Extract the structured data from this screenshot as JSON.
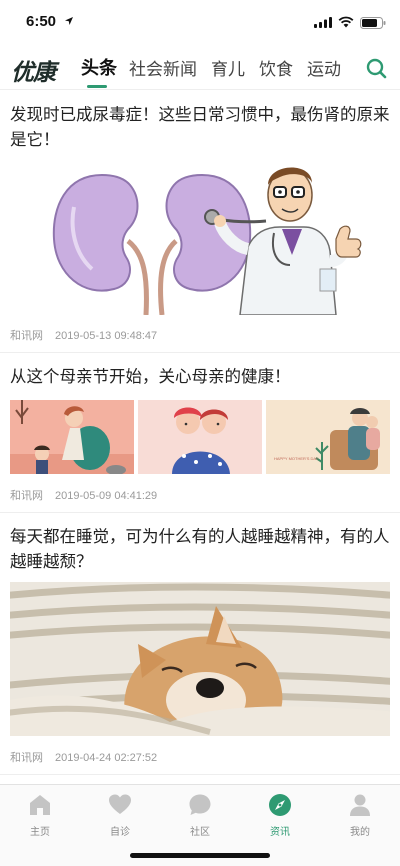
{
  "status": {
    "time": "6:50"
  },
  "header": {
    "logo": "优康",
    "tabs": [
      {
        "label": "头条",
        "active": true
      },
      {
        "label": "社会新闻",
        "active": false
      },
      {
        "label": "育儿",
        "active": false
      },
      {
        "label": "饮食",
        "active": false
      },
      {
        "label": "运动",
        "active": false
      }
    ]
  },
  "articles": [
    {
      "title": "发现时已成尿毒症！这些日常习惯中，最伤肾的原来是它！",
      "source": "和讯网",
      "time": "2019-05-13 09:48:47"
    },
    {
      "title": "从这个母亲节开始，关心母亲的健康！",
      "source": "和讯网",
      "time": "2019-05-09 04:41:29",
      "card_text": "HAPPY MOTHER'S DAY"
    },
    {
      "title": "每天都在睡觉，可为什么有的人越睡越精神，有的人越睡越颓？",
      "source": "和讯网",
      "time": "2019-04-24 02:27:52"
    }
  ],
  "tabbar": [
    {
      "label": "主页",
      "icon": "home-icon",
      "active": false
    },
    {
      "label": "自诊",
      "icon": "heart-icon",
      "active": false
    },
    {
      "label": "社区",
      "icon": "chat-bubble-icon",
      "active": false
    },
    {
      "label": "资讯",
      "icon": "compass-icon",
      "active": true
    },
    {
      "label": "我的",
      "icon": "person-icon",
      "active": false
    }
  ],
  "colors": {
    "accent": "#2e9a72",
    "inactive": "#bdbdbd"
  }
}
